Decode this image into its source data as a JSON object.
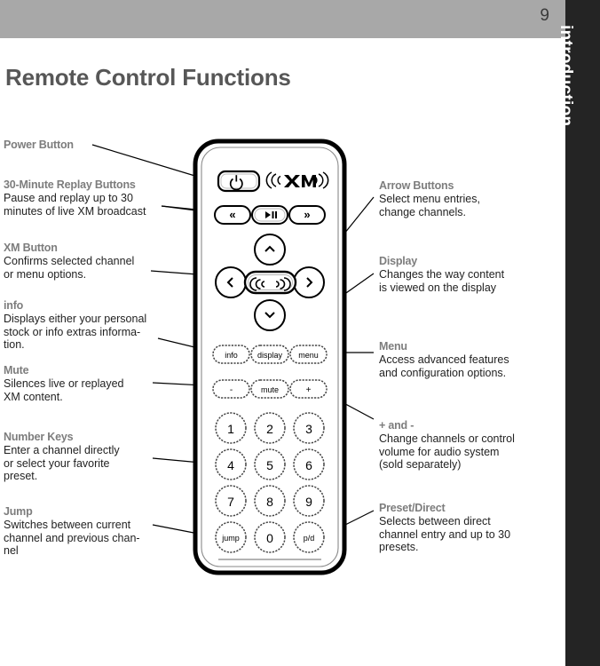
{
  "header": {
    "page_number": "9",
    "section_tab": "introduction"
  },
  "page_title": "Remote Control Functions",
  "annotations_left": [
    {
      "id": "power-button",
      "title": "Power Button",
      "body": ""
    },
    {
      "id": "replay-buttons",
      "title": "30-Minute Replay Buttons",
      "body": "Pause and replay up to 30\nminutes of live XM broadcast"
    },
    {
      "id": "xm-button",
      "title": "XM Button",
      "body": "Confirms selected channel\nor menu options."
    },
    {
      "id": "info",
      "title": "info",
      "body": "Displays either your personal\nstock or info extras informa-\ntion."
    },
    {
      "id": "mute",
      "title": "Mute",
      "body": "Silences live or replayed\nXM content."
    },
    {
      "id": "number-keys",
      "title": "Number Keys",
      "body": "Enter a channel directly\nor select your favorite\npreset."
    },
    {
      "id": "jump",
      "title": "Jump",
      "body": "Switches between current\nchannel and previous chan-\nnel"
    }
  ],
  "annotations_right": [
    {
      "id": "arrow-buttons",
      "title": "Arrow Buttons",
      "body": "Select menu entries,\nchange channels."
    },
    {
      "id": "display",
      "title": "Display",
      "body": "Changes the way content\nis viewed on the display"
    },
    {
      "id": "menu",
      "title": "Menu",
      "body": "Access advanced features\nand configuration options."
    },
    {
      "id": "plus-minus",
      "title": "+ and -",
      "body": "Change channels or control\nvolume for audio system\n(sold separately)"
    },
    {
      "id": "preset-direct",
      "title": "Preset/Direct",
      "body": "Selects between direct\nchannel entry and up to 30\npresets."
    }
  ],
  "remote": {
    "brand_logo": "(((XM)))",
    "power_icon": "power-icon",
    "replay_row": [
      {
        "id": "rewind",
        "label": "rewind-icon",
        "glyph": "«"
      },
      {
        "id": "play-pause",
        "label": "play-pause-icon",
        "glyph": "▸‖"
      },
      {
        "id": "forward",
        "label": "forward-icon",
        "glyph": "»"
      }
    ],
    "dpad": {
      "up": "˄",
      "down": "˅",
      "left": "‹",
      "right": "›",
      "center": "xm-wave-icon"
    },
    "soft_row": [
      {
        "id": "info",
        "label": "info"
      },
      {
        "id": "display",
        "label": "display"
      },
      {
        "id": "menu",
        "label": "menu"
      }
    ],
    "volume_row": [
      {
        "id": "minus",
        "label": "-"
      },
      {
        "id": "mute",
        "label": "mute"
      },
      {
        "id": "plus",
        "label": "+"
      }
    ],
    "keypad": [
      [
        {
          "id": "key-1",
          "label": "1"
        },
        {
          "id": "key-2",
          "label": "2"
        },
        {
          "id": "key-3",
          "label": "3"
        }
      ],
      [
        {
          "id": "key-4",
          "label": "4"
        },
        {
          "id": "key-5",
          "label": "5"
        },
        {
          "id": "key-6",
          "label": "6"
        }
      ],
      [
        {
          "id": "key-7",
          "label": "7"
        },
        {
          "id": "key-8",
          "label": "8"
        },
        {
          "id": "key-9",
          "label": "9"
        }
      ],
      [
        {
          "id": "key-jump",
          "label": "jump"
        },
        {
          "id": "key-0",
          "label": "0"
        },
        {
          "id": "key-pd",
          "label": "p/d"
        }
      ]
    ]
  },
  "colors": {
    "header_gray": "#a8a8a8",
    "tab_dark": "#242424",
    "title_gray": "#575757",
    "label_gray": "#7d7d7d",
    "body_text": "#222222",
    "line_black": "#000000"
  }
}
